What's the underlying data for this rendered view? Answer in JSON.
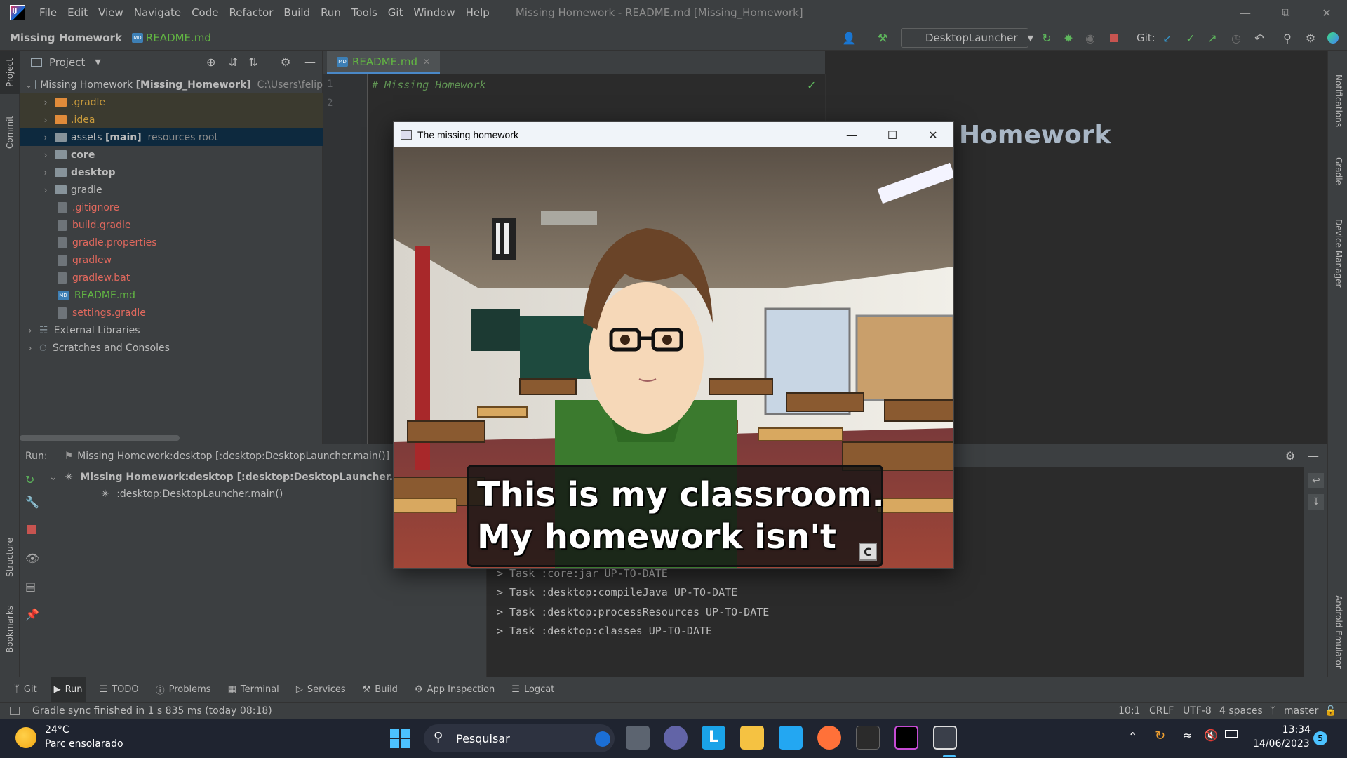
{
  "menu": {
    "items": [
      "File",
      "Edit",
      "View",
      "Navigate",
      "Code",
      "Refactor",
      "Build",
      "Run",
      "Tools",
      "Git",
      "Window",
      "Help"
    ],
    "window_title": "Missing Homework - README.md [Missing_Homework]"
  },
  "navbar": {
    "project": "Missing Homework",
    "file": "README.md",
    "run_config": "DesktopLauncher",
    "git_label": "Git:"
  },
  "project_panel": {
    "title": "Project",
    "root_name": "Missing Homework",
    "root_module": "[Missing_Homework]",
    "root_path": "C:\\Users\\felip",
    "items": [
      {
        "label": ".gradle",
        "color": "#c89a3c"
      },
      {
        "label": ".idea",
        "color": "#c89a3c"
      },
      {
        "label": "assets",
        "bold_suffix": "[main]",
        "hint": "resources root",
        "color": "#bbbbbb"
      },
      {
        "label": "core",
        "color": "#bbbbbb"
      },
      {
        "label": "desktop",
        "color": "#bbbbbb"
      },
      {
        "label": "gradle",
        "color": "#bbbbbb"
      },
      {
        "label": ".gitignore",
        "color": "#e0685d"
      },
      {
        "label": "build.gradle",
        "color": "#e0685d"
      },
      {
        "label": "gradle.properties",
        "color": "#e0685d"
      },
      {
        "label": "gradlew",
        "color": "#e0685d"
      },
      {
        "label": "gradlew.bat",
        "color": "#e0685d"
      },
      {
        "label": "README.md",
        "color": "#62b543"
      },
      {
        "label": "settings.gradle",
        "color": "#e0685d"
      },
      {
        "label": "External Libraries",
        "color": "#bbbbbb"
      },
      {
        "label": "Scratches and Consoles",
        "color": "#bbbbbb"
      }
    ]
  },
  "editor": {
    "tab": "README.md",
    "line_numbers": [
      "1",
      "2"
    ],
    "code": "# Missing Homework",
    "preview_heading": "Homework"
  },
  "left_strip": {
    "project": "Project",
    "commit": "Commit",
    "structure": "Structure",
    "bookmarks": "Bookmarks"
  },
  "right_strip": {
    "notifications": "Notifications",
    "gradle": "Gradle",
    "device_manager": "Device Manager",
    "emulator": "Android Emulator"
  },
  "run": {
    "label": "Run:",
    "tab": "Missing Homework:desktop [:desktop:DesktopLauncher.main()]",
    "tree_root": "Missing Homework:desktop [:desktop:DesktopLauncher.main()]",
    "tree_child": ":desktop:DesktopLauncher.main()",
    "console": [
      "> Task :core:jar UP-TO-DATE",
      "> Task :desktop:compileJava UP-TO-DATE",
      "> Task :desktop:processResources UP-TO-DATE",
      "> Task :desktop:classes UP-TO-DATE"
    ]
  },
  "tool_tabs": [
    "Git",
    "Run",
    "TODO",
    "Problems",
    "Terminal",
    "Services",
    "Build",
    "App Inspection",
    "Logcat"
  ],
  "statusbar": {
    "message": "Gradle sync finished in 1 s 835 ms (today 08:18)",
    "position": "10:1",
    "line_sep": "CRLF",
    "encoding": "UTF-8",
    "indent": "4 spaces",
    "branch": "master"
  },
  "game": {
    "window_title": "The missing homework",
    "dialog_line1": "This is my classroom.",
    "dialog_line2": "My homework isn't",
    "continue_key": "C"
  },
  "taskbar": {
    "temperature": "24°C",
    "weather": "Parc ensolarado",
    "search": "Pesquisar",
    "time": "13:34",
    "date": "14/06/2023",
    "notifications": "5"
  }
}
